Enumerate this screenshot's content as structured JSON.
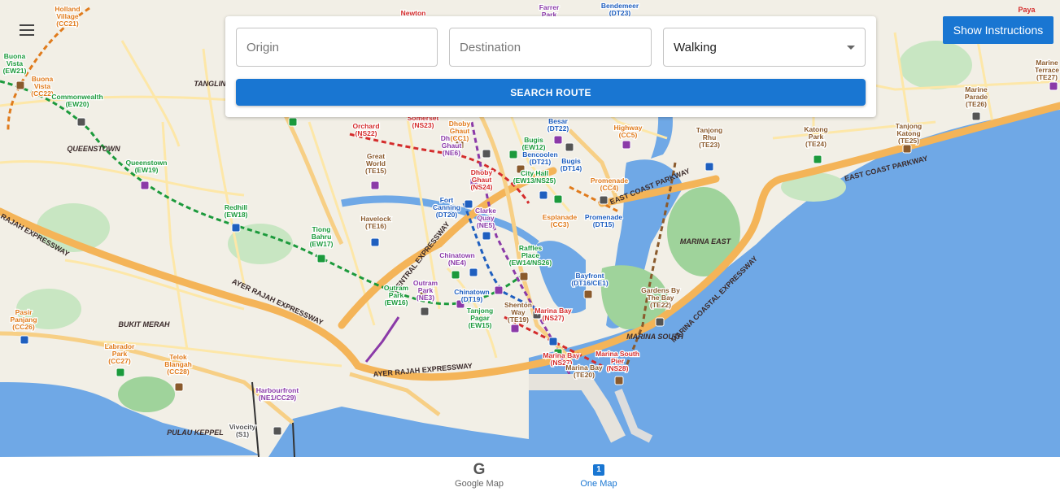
{
  "search": {
    "origin_placeholder": "Origin",
    "destination_placeholder": "Destination",
    "mode_value": "Walking",
    "search_button": "SEARCH ROUTE"
  },
  "show_instructions": "Show Instructions",
  "bottom_tabs": [
    {
      "label": "Google Map",
      "icon": "G"
    },
    {
      "label": "One Map",
      "icon": "1"
    }
  ],
  "map": {
    "areas": [
      "TANGLIN",
      "QUEENSTOWN",
      "BUKIT MERAH",
      "MARINA EAST",
      "MARINA SOUTH",
      "PULAU KEPPEL"
    ],
    "roads": [
      "AYER RAJAH EXPRESSWAY",
      "AYER RAJAH EXPRESSWAY",
      "AYER RAJAH EXPRESSWAY",
      "CENTRAL EXPRESSWAY",
      "EAST COAST PARKWAY",
      "EAST COAST PARKWAY",
      "MARINA COASTAL EXPRESSWAY",
      "Paya"
    ],
    "stations": [
      {
        "name": "Holland Village",
        "code": "(CC21)",
        "color": "#e07b1c"
      },
      {
        "name": "Buona Vista",
        "code": "(EW21)",
        "color": "#1c9a3c"
      },
      {
        "name": "Buona Vista",
        "code": "(CC22)",
        "color": "#e07b1c"
      },
      {
        "name": "Commonwealth",
        "code": "(EW20)",
        "color": "#1c9a3c"
      },
      {
        "name": "Queenstown",
        "code": "(EW19)",
        "color": "#1c9a3c"
      },
      {
        "name": "Redhill",
        "code": "(EW18)",
        "color": "#1c9a3c"
      },
      {
        "name": "Tiong Bahru",
        "code": "(EW17)",
        "color": "#1c9a3c"
      },
      {
        "name": "Outram Park",
        "code": "(EW16)",
        "color": "#1c9a3c"
      },
      {
        "name": "Outram Park",
        "code": "(NE3)",
        "color": "#8b3aa8"
      },
      {
        "name": "Tanjong Pagar",
        "code": "(EW15)",
        "color": "#1c9a3c"
      },
      {
        "name": "Somerset",
        "code": "(NS23)",
        "color": "#d42c2c"
      },
      {
        "name": "Orchard",
        "code": "(NS22)",
        "color": "#d42c2c"
      },
      {
        "name": "Dhoby Ghaut",
        "code": "(NS24)",
        "color": "#d42c2c"
      },
      {
        "name": "Dhoby Ghaut",
        "code": "(NE6)",
        "color": "#8b3aa8"
      },
      {
        "name": "Dhoby Ghaut",
        "code": "(CC1)",
        "color": "#e07b1c"
      },
      {
        "name": "Great World",
        "code": "(TE15)",
        "color": "#8a5a2c"
      },
      {
        "name": "Havelock",
        "code": "(TE16)",
        "color": "#8a5a2c"
      },
      {
        "name": "Fort Canning",
        "code": "(DT20)",
        "color": "#1f5fbf"
      },
      {
        "name": "Clarke Quay",
        "code": "(NE5)",
        "color": "#8b3aa8"
      },
      {
        "name": "Chinatown",
        "code": "(NE4)",
        "color": "#8b3aa8"
      },
      {
        "name": "Chinatown",
        "code": "(DT19)",
        "color": "#1f5fbf"
      },
      {
        "name": "Shenton Way",
        "code": "(TE19)",
        "color": "#8a5a2c"
      },
      {
        "name": "Bugis",
        "code": "(EW12)",
        "color": "#1c9a3c"
      },
      {
        "name": "Bencoolen",
        "code": "(DT21)",
        "color": "#1f5fbf"
      },
      {
        "name": "Bugis",
        "code": "(DT14)",
        "color": "#1f5fbf"
      },
      {
        "name": "City Hall",
        "code": "(EW13/NS25)",
        "color": "#1c9a3c"
      },
      {
        "name": "Besar",
        "code": "(DT22)",
        "color": "#1f5fbf"
      },
      {
        "name": "Esplanade",
        "code": "(CC3)",
        "color": "#e07b1c"
      },
      {
        "name": "Promenade",
        "code": "(CC4)",
        "color": "#e07b1c"
      },
      {
        "name": "Promenade",
        "code": "(DT15)",
        "color": "#1f5fbf"
      },
      {
        "name": "Raffles Place",
        "code": "(EW14/NS26)",
        "color": "#1c9a3c"
      },
      {
        "name": "Bayfront",
        "code": "(DT16/CE1)",
        "color": "#1f5fbf"
      },
      {
        "name": "Marina Bay",
        "code": "(NS27)",
        "color": "#d42c2c"
      },
      {
        "name": "Marina Bay",
        "code": "(NS27)",
        "color": "#d42c2c"
      },
      {
        "name": "Marina Bay",
        "code": "(TE20)",
        "color": "#8a5a2c"
      },
      {
        "name": "Marina South Pier",
        "code": "(NS28)",
        "color": "#d42c2c"
      },
      {
        "name": "Gardens By The Bay",
        "code": "(TE22)",
        "color": "#8a5a2c"
      },
      {
        "name": "Highway",
        "code": "(CC5)",
        "color": "#e07b1c"
      },
      {
        "name": "Tanjong Rhu",
        "code": "(TE23)",
        "color": "#8a5a2c"
      },
      {
        "name": "Katong Park",
        "code": "(TE24)",
        "color": "#8a5a2c"
      },
      {
        "name": "Tanjong Katong",
        "code": "(TE25)",
        "color": "#8a5a2c"
      },
      {
        "name": "Marine Parade",
        "code": "(TE26)",
        "color": "#8a5a2c"
      },
      {
        "name": "Marine Terrace",
        "code": "(TE27)",
        "color": "#8a5a2c"
      },
      {
        "name": "Pasir Panjang",
        "code": "(CC26)",
        "color": "#e07b1c"
      },
      {
        "name": "Labrador Park",
        "code": "(CC27)",
        "color": "#e07b1c"
      },
      {
        "name": "Telok Blangah",
        "code": "(CC28)",
        "color": "#e07b1c"
      },
      {
        "name": "Harbourfront",
        "code": "(NE1/CC29)",
        "color": "#8b3aa8"
      },
      {
        "name": "Vivocity",
        "code": "(S1)",
        "color": "#555555"
      },
      {
        "name": "Farrer Park",
        "code": "",
        "color": "#8b3aa8"
      },
      {
        "name": "Bendemeer",
        "code": "(DT23)",
        "color": "#1f5fbf"
      },
      {
        "name": "Newton",
        "code": "",
        "color": "#d42c2c"
      }
    ]
  },
  "colors": {
    "accent": "#1976d2",
    "sea": "#6fa8e6",
    "land": "#f2efe6",
    "park": "#9fd39b",
    "expressway": "#f4b458",
    "road": "#fde7a8"
  }
}
